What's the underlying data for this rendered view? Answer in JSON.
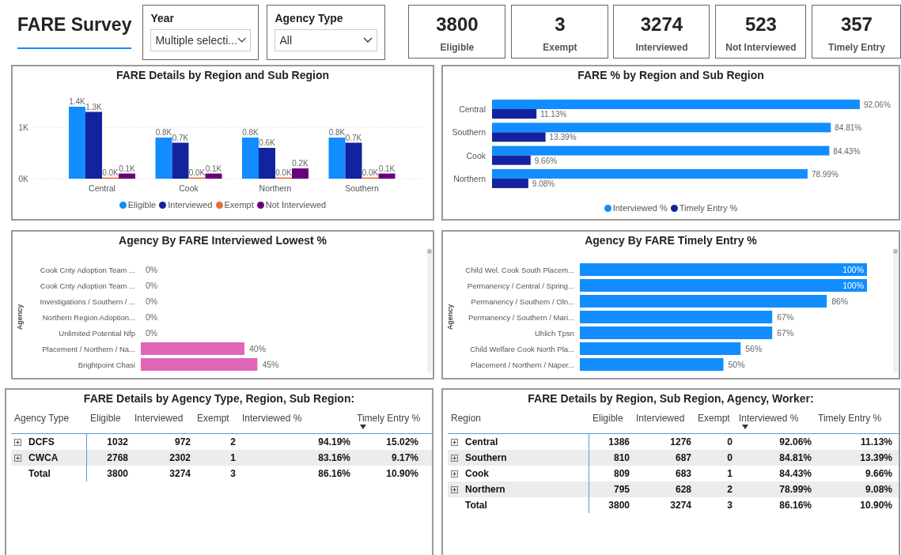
{
  "header": {
    "title": "FARE Survey"
  },
  "slicers": [
    {
      "label": "Year",
      "value": "Multiple selecti..."
    },
    {
      "label": "Agency Type",
      "value": "All"
    }
  ],
  "cards": [
    {
      "value": "3800",
      "label": "Eligible"
    },
    {
      "value": "3",
      "label": "Exempt"
    },
    {
      "value": "3274",
      "label": "Interviewed"
    },
    {
      "value": "523",
      "label": "Not Interviewed"
    },
    {
      "value": "357",
      "label": "Timely Entry"
    }
  ],
  "region_chart": {
    "chart_data": {
      "type": "bar",
      "title": "FARE Details by Region and Sub Region",
      "categories": [
        "Central",
        "Cook",
        "Northern",
        "Southern"
      ],
      "series": [
        {
          "name": "Eligible",
          "color": "#118dff",
          "values": [
            1400,
            800,
            800,
            800
          ],
          "value_labels": [
            "1.4K",
            "0.8K",
            "0.8K",
            "0.8K"
          ]
        },
        {
          "name": "Interviewed",
          "color": "#12239e",
          "values": [
            1300,
            700,
            600,
            700
          ],
          "value_labels": [
            "1.3K",
            "0.7K",
            "0.6K",
            "0.7K"
          ]
        },
        {
          "name": "Exempt",
          "color": "#e66c37",
          "values": [
            0,
            0,
            0,
            0
          ],
          "value_labels": [
            "0.0K",
            "0.0K",
            "0.0K",
            "0.0K"
          ]
        },
        {
          "name": "Not Interviewed",
          "color": "#6b007b",
          "values": [
            100,
            100,
            200,
            100
          ],
          "value_labels": [
            "0.1K",
            "0.1K",
            "0.2K",
            "0.1K"
          ]
        }
      ],
      "yticks": [
        {
          "value": 0,
          "label": "0K"
        },
        {
          "value": 1000,
          "label": "1K"
        }
      ],
      "ylim": [
        0,
        1400
      ],
      "legend": "bottom"
    }
  },
  "percent_chart": {
    "chart_data": {
      "type": "bar",
      "orientation": "horizontal",
      "title": "FARE % by Region and Sub Region",
      "categories": [
        "Central",
        "Southern",
        "Cook",
        "Northern"
      ],
      "series": [
        {
          "name": "Interviewed %",
          "color": "#118dff",
          "values": [
            92.06,
            84.81,
            84.43,
            78.99
          ],
          "value_labels": [
            "92.06%",
            "84.81%",
            "84.43%",
            "78.99%"
          ]
        },
        {
          "name": "Timely Entry %",
          "color": "#12239e",
          "values": [
            11.13,
            13.39,
            9.66,
            9.08
          ],
          "value_labels": [
            "11.13%",
            "13.39%",
            "9.66%",
            "9.08%"
          ]
        }
      ],
      "legend": "bottom"
    }
  },
  "lowest_chart": {
    "chart_data": {
      "type": "bar",
      "orientation": "horizontal",
      "title": "Agency By FARE Interviewed Lowest %",
      "ylabel": "Agency",
      "categories": [
        "Cook Cnty Adoption Team ...",
        "Cook Cnty Adoption Team ...",
        "Investigations / Southern / ...",
        "Northern Region Adoption...",
        "Unlimited Potential Nfp",
        "Placement / Northern / Na...",
        "Brightpoint Chasi"
      ],
      "series": [
        {
          "color": "#e066b8",
          "values": [
            0,
            0,
            0,
            0,
            0,
            40,
            45
          ],
          "value_labels": [
            "0%",
            "0%",
            "0%",
            "0%",
            "0%",
            "40%",
            "45%"
          ]
        }
      ]
    }
  },
  "timely_chart": {
    "chart_data": {
      "type": "bar",
      "orientation": "horizontal",
      "title": "Agency By FARE Timely Entry %",
      "ylabel": "Agency",
      "categories": [
        "Child Wel. Cook South Placem...",
        "Permanency / Central / Spring...",
        "Permanency / Southern / Oln...",
        "Permanency / Southern / Mari...",
        "Uhlich Tpsn",
        "Child Welfare Cook North Pla...",
        "Placement / Northern / Naper..."
      ],
      "series": [
        {
          "color": "#118dff",
          "values": [
            100,
            100,
            86,
            67,
            67,
            56,
            50
          ],
          "value_labels": [
            "100%",
            "100%",
            "86%",
            "67%",
            "67%",
            "56%",
            "50%"
          ]
        }
      ]
    }
  },
  "tables": [
    {
      "title": "FARE Details by Agency Type, Region, Sub Region:",
      "columns": [
        {
          "label": "Agency Type",
          "sorted": false
        },
        {
          "label": "Eligible",
          "sorted": false
        },
        {
          "label": "Interviewed",
          "sorted": false
        },
        {
          "label": "Exempt",
          "sorted": false
        },
        {
          "label": "Interviewed %",
          "sorted": false
        },
        {
          "label": "Timely Entry %",
          "sorted": true
        }
      ],
      "rows": [
        {
          "kind": "group",
          "cells": [
            "DCFS",
            "1032",
            "972",
            "2",
            "94.19%",
            "15.02%"
          ]
        },
        {
          "kind": "group",
          "cells": [
            "CWCA",
            "2768",
            "2302",
            "1",
            "83.16%",
            "9.17%"
          ]
        },
        {
          "kind": "total",
          "cells": [
            "Total",
            "3800",
            "3274",
            "3",
            "86.16%",
            "10.90%"
          ]
        }
      ]
    },
    {
      "title": "FARE Details by Region, Sub Region, Agency, Worker:",
      "columns": [
        {
          "label": "Region",
          "sorted": false
        },
        {
          "label": "Eligible",
          "sorted": false
        },
        {
          "label": "Interviewed",
          "sorted": false
        },
        {
          "label": "Exempt",
          "sorted": false
        },
        {
          "label": "Interviewed %",
          "sorted": true
        },
        {
          "label": "Timely Entry %",
          "sorted": false
        }
      ],
      "rows": [
        {
          "kind": "group",
          "cells": [
            "Central",
            "1386",
            "1276",
            "0",
            "92.06%",
            "11.13%"
          ]
        },
        {
          "kind": "group",
          "cells": [
            "Southern",
            "810",
            "687",
            "0",
            "84.81%",
            "13.39%"
          ]
        },
        {
          "kind": "group",
          "cells": [
            "Cook",
            "809",
            "683",
            "1",
            "84.43%",
            "9.66%"
          ]
        },
        {
          "kind": "group",
          "cells": [
            "Northern",
            "795",
            "628",
            "2",
            "78.99%",
            "9.08%"
          ]
        },
        {
          "kind": "total",
          "cells": [
            "Total",
            "3800",
            "3274",
            "3",
            "86.16%",
            "10.90%"
          ]
        }
      ]
    }
  ]
}
